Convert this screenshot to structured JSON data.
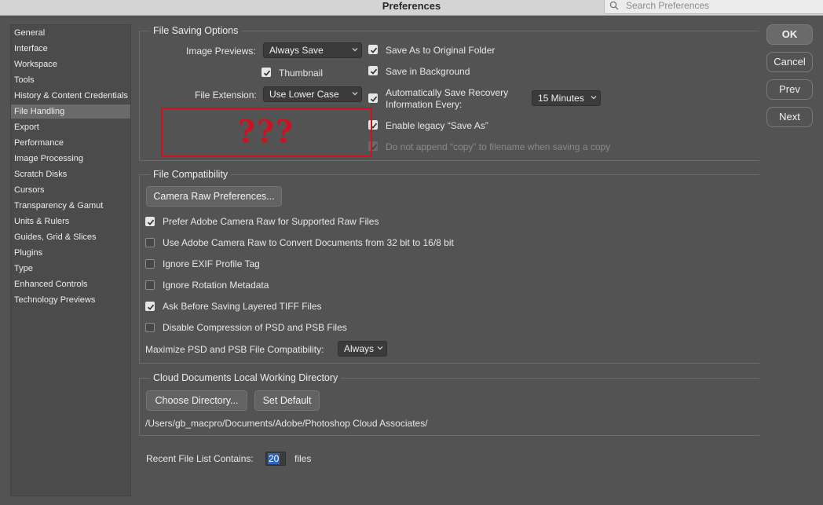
{
  "window": {
    "title": "Preferences"
  },
  "search": {
    "placeholder": "Search Preferences"
  },
  "sidebar": {
    "items": [
      {
        "label": "General"
      },
      {
        "label": "Interface"
      },
      {
        "label": "Workspace"
      },
      {
        "label": "Tools"
      },
      {
        "label": "History & Content Credentials"
      },
      {
        "label": "File Handling"
      },
      {
        "label": "Export"
      },
      {
        "label": "Performance"
      },
      {
        "label": "Image Processing"
      },
      {
        "label": "Scratch Disks"
      },
      {
        "label": "Cursors"
      },
      {
        "label": "Transparency & Gamut"
      },
      {
        "label": "Units & Rulers"
      },
      {
        "label": "Guides, Grid & Slices"
      },
      {
        "label": "Plugins"
      },
      {
        "label": "Type"
      },
      {
        "label": "Enhanced Controls"
      },
      {
        "label": "Technology Previews"
      }
    ],
    "active_index": 5
  },
  "file_saving": {
    "title": "File Saving Options",
    "image_previews_label": "Image Previews:",
    "image_previews_value": "Always Save",
    "thumbnail_label": "Thumbnail",
    "thumbnail_checked": true,
    "file_extension_label": "File Extension:",
    "file_extension_value": "Use Lower Case",
    "save_original_label": "Save As to Original Folder",
    "save_original_checked": true,
    "save_background_label": "Save in Background",
    "save_background_checked": true,
    "recovery_label_line1": "Automatically Save Recovery",
    "recovery_label_line2": "Information Every:",
    "recovery_checked": true,
    "recovery_interval": "15 Minutes",
    "legacy_label": "Enable legacy “Save As”",
    "legacy_checked": true,
    "no_copy_label": "Do not append “copy” to filename when saving a copy",
    "no_copy_checked": true,
    "redacted_mark": "???"
  },
  "file_compat": {
    "title": "File Compatibility",
    "camera_raw_button": "Camera Raw Preferences...",
    "options": [
      {
        "label": "Prefer Adobe Camera Raw for Supported Raw Files",
        "checked": true
      },
      {
        "label": "Use Adobe Camera Raw to Convert Documents from 32 bit to 16/8 bit",
        "checked": false
      },
      {
        "label": "Ignore EXIF Profile Tag",
        "checked": false
      },
      {
        "label": "Ignore Rotation Metadata",
        "checked": false
      },
      {
        "label": "Ask Before Saving Layered TIFF Files",
        "checked": true
      },
      {
        "label": "Disable Compression of PSD and PSB Files",
        "checked": false
      }
    ],
    "maximize_label": "Maximize PSD and PSB File Compatibility:",
    "maximize_value": "Always"
  },
  "cloud": {
    "title": "Cloud Documents Local Working Directory",
    "choose_button": "Choose Directory...",
    "default_button": "Set Default",
    "path": "/Users/gb_macpro/Documents/Adobe/Photoshop Cloud Associates/"
  },
  "recent": {
    "label": "Recent File List Contains:",
    "value": "20",
    "suffix": "files"
  },
  "buttons": {
    "ok": "OK",
    "cancel": "Cancel",
    "prev": "Prev",
    "next": "Next"
  },
  "colors": {
    "background": "#535353",
    "accent_selection": "#2f63b6",
    "redaction": "#d01020"
  }
}
